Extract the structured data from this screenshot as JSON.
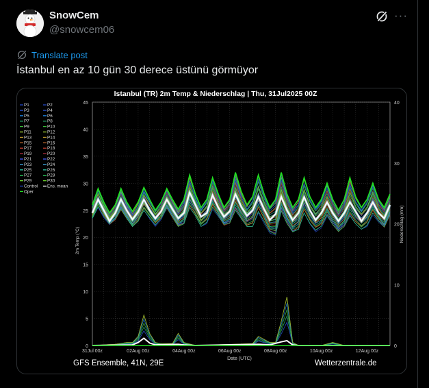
{
  "author": {
    "name": "SnowCem",
    "handle": "@snowcem06"
  },
  "translate_label": "Translate post",
  "tweet_text": "İstanbul en az 10 gün 30 derece üstünü görmüyor",
  "chart_data": {
    "type": "line",
    "title": "Istanbul  (TR)  2m Temp & Niederschlag | Thu, 31Jul2025 00Z",
    "footer_left": "GFS Ensemble, 41N, 29E",
    "footer_right": "Wetterzentrale.de",
    "xlabel": "Date (UTC)",
    "ylabel_left": "2m Temp (°C)",
    "ylabel_right": "Niederschlag (mm)",
    "ylim_left": [
      0,
      45
    ],
    "ylim_right": [
      0,
      40
    ],
    "yticks_left": [
      "0",
      "5",
      "10",
      "15",
      "20",
      "25",
      "30",
      "35",
      "40",
      "45"
    ],
    "yticks_right": [
      "0",
      "10",
      "20",
      "30",
      "40"
    ],
    "x_range_hours": [
      0,
      312
    ],
    "xticks": [
      {
        "hour": 0,
        "label": "31Jul 00z"
      },
      {
        "hour": 48,
        "label": "02Aug 00z"
      },
      {
        "hour": 96,
        "label": "04Aug 00z"
      },
      {
        "hour": 144,
        "label": "06Aug 00z"
      },
      {
        "hour": 192,
        "label": "08Aug 00z"
      },
      {
        "hour": 240,
        "label": "10Aug 00z"
      },
      {
        "hour": 288,
        "label": "12Aug 00z"
      }
    ],
    "legend_placement": "left",
    "legend": [
      {
        "name": "P1",
        "color": "#1f3fae"
      },
      {
        "name": "P2",
        "color": "#1f3fae"
      },
      {
        "name": "P3",
        "color": "#2a55d8"
      },
      {
        "name": "P4",
        "color": "#2a55d8"
      },
      {
        "name": "P5",
        "color": "#1c7fd8"
      },
      {
        "name": "P6",
        "color": "#1c7fd8"
      },
      {
        "name": "P7",
        "color": "#24a86a"
      },
      {
        "name": "P8",
        "color": "#24a86a"
      },
      {
        "name": "P9",
        "color": "#38b838"
      },
      {
        "name": "P10",
        "color": "#38b838"
      },
      {
        "name": "P11",
        "color": "#8fb82e"
      },
      {
        "name": "P12",
        "color": "#8fb82e"
      },
      {
        "name": "P13",
        "color": "#b38f2a"
      },
      {
        "name": "P14",
        "color": "#b38f2a"
      },
      {
        "name": "P15",
        "color": "#b8652a"
      },
      {
        "name": "P16",
        "color": "#b8652a"
      },
      {
        "name": "P17",
        "color": "#b83a2a"
      },
      {
        "name": "P18",
        "color": "#b83a2a"
      },
      {
        "name": "P19",
        "color": "#a82a3a"
      },
      {
        "name": "P20",
        "color": "#a82a3a"
      },
      {
        "name": "P21",
        "color": "#3a4fd8"
      },
      {
        "name": "P22",
        "color": "#3a4fd8"
      },
      {
        "name": "P23",
        "color": "#3aa0d8"
      },
      {
        "name": "P24",
        "color": "#3aa0d8"
      },
      {
        "name": "P25",
        "color": "#2ac0a0"
      },
      {
        "name": "P26",
        "color": "#2ac0a0"
      },
      {
        "name": "P27",
        "color": "#2ad060"
      },
      {
        "name": "P28",
        "color": "#2ad060"
      },
      {
        "name": "P29",
        "color": "#6ad02a"
      },
      {
        "name": "P30",
        "color": "#6ad02a"
      },
      {
        "name": "Control",
        "color": "#1f3fae"
      },
      {
        "name": "Ens. mean",
        "color": "#ffffff"
      },
      {
        "name": "Oper",
        "color": "#22dd22"
      }
    ],
    "temp_mean": [
      [
        0,
        24.5
      ],
      [
        6,
        27
      ],
      [
        12,
        25
      ],
      [
        18,
        23
      ],
      [
        24,
        24.5
      ],
      [
        30,
        27
      ],
      [
        36,
        25
      ],
      [
        42,
        23.3
      ],
      [
        48,
        24.7
      ],
      [
        54,
        27
      ],
      [
        60,
        25
      ],
      [
        66,
        23.5
      ],
      [
        72,
        24.8
      ],
      [
        78,
        27
      ],
      [
        84,
        25.2
      ],
      [
        90,
        23.5
      ],
      [
        96,
        24.5
      ],
      [
        102,
        28.3
      ],
      [
        108,
        26
      ],
      [
        114,
        23.8
      ],
      [
        120,
        24.5
      ],
      [
        126,
        27.8
      ],
      [
        132,
        25.5
      ],
      [
        138,
        23.8
      ],
      [
        144,
        24.8
      ],
      [
        150,
        28
      ],
      [
        156,
        25.7
      ],
      [
        162,
        24
      ],
      [
        168,
        25
      ],
      [
        174,
        27.5
      ],
      [
        180,
        25.2
      ],
      [
        186,
        23.2
      ],
      [
        192,
        24.3
      ],
      [
        198,
        27.5
      ],
      [
        204,
        25
      ],
      [
        210,
        23.2
      ],
      [
        216,
        24.5
      ],
      [
        222,
        27.5
      ],
      [
        228,
        25
      ],
      [
        234,
        23.2
      ],
      [
        240,
        24.5
      ],
      [
        246,
        26.5
      ],
      [
        252,
        24.5
      ],
      [
        258,
        23
      ],
      [
        264,
        24.5
      ],
      [
        270,
        26.5
      ],
      [
        276,
        24.8
      ],
      [
        282,
        23
      ],
      [
        288,
        24.5
      ],
      [
        294,
        26.5
      ],
      [
        300,
        24.5
      ],
      [
        306,
        23.5
      ],
      [
        312,
        26
      ]
    ],
    "temp_spread_max": [
      [
        0,
        26
      ],
      [
        6,
        29
      ],
      [
        12,
        26.5
      ],
      [
        18,
        24.5
      ],
      [
        24,
        26
      ],
      [
        30,
        29
      ],
      [
        36,
        26.5
      ],
      [
        42,
        24.8
      ],
      [
        48,
        26.5
      ],
      [
        54,
        29.2
      ],
      [
        60,
        27
      ],
      [
        66,
        25
      ],
      [
        72,
        26.5
      ],
      [
        78,
        29
      ],
      [
        84,
        27
      ],
      [
        90,
        25.2
      ],
      [
        96,
        27
      ],
      [
        102,
        31.5
      ],
      [
        108,
        28
      ],
      [
        114,
        25.5
      ],
      [
        120,
        27
      ],
      [
        126,
        31
      ],
      [
        132,
        28
      ],
      [
        138,
        25.5
      ],
      [
        144,
        27
      ],
      [
        150,
        32
      ],
      [
        156,
        28.5
      ],
      [
        162,
        26
      ],
      [
        168,
        27.5
      ],
      [
        174,
        31.5
      ],
      [
        180,
        28
      ],
      [
        186,
        25.5
      ],
      [
        192,
        27
      ],
      [
        198,
        32
      ],
      [
        204,
        28
      ],
      [
        210,
        25.5
      ],
      [
        216,
        27
      ],
      [
        222,
        31
      ],
      [
        228,
        27.5
      ],
      [
        234,
        25.5
      ],
      [
        240,
        27
      ],
      [
        246,
        30
      ],
      [
        252,
        27
      ],
      [
        258,
        25
      ],
      [
        264,
        27
      ],
      [
        270,
        31
      ],
      [
        276,
        27.5
      ],
      [
        282,
        25.5
      ],
      [
        288,
        27
      ],
      [
        294,
        30
      ],
      [
        300,
        27
      ],
      [
        306,
        25.5
      ],
      [
        312,
        28
      ]
    ],
    "temp_spread_min": [
      [
        0,
        23.5
      ],
      [
        6,
        25.5
      ],
      [
        12,
        23.5
      ],
      [
        18,
        22
      ],
      [
        24,
        23
      ],
      [
        30,
        25
      ],
      [
        36,
        23.5
      ],
      [
        42,
        22
      ],
      [
        48,
        23
      ],
      [
        54,
        25
      ],
      [
        60,
        23.5
      ],
      [
        66,
        22
      ],
      [
        72,
        23
      ],
      [
        78,
        25
      ],
      [
        84,
        23.5
      ],
      [
        90,
        22
      ],
      [
        96,
        22.5
      ],
      [
        102,
        25.5
      ],
      [
        108,
        24
      ],
      [
        114,
        22
      ],
      [
        120,
        22.5
      ],
      [
        126,
        25
      ],
      [
        132,
        23.5
      ],
      [
        138,
        22
      ],
      [
        144,
        22.5
      ],
      [
        150,
        25
      ],
      [
        156,
        23.5
      ],
      [
        162,
        22
      ],
      [
        168,
        22
      ],
      [
        174,
        24.5
      ],
      [
        180,
        22.5
      ],
      [
        186,
        20.5
      ],
      [
        192,
        20
      ],
      [
        198,
        24.5
      ],
      [
        204,
        22.5
      ],
      [
        210,
        21
      ],
      [
        216,
        21.5
      ],
      [
        222,
        24.5
      ],
      [
        228,
        22.5
      ],
      [
        234,
        21
      ],
      [
        240,
        21.5
      ],
      [
        246,
        23.5
      ],
      [
        252,
        22
      ],
      [
        258,
        21
      ],
      [
        264,
        22
      ],
      [
        270,
        24
      ],
      [
        276,
        22.5
      ],
      [
        282,
        21.5
      ],
      [
        288,
        22
      ],
      [
        294,
        24
      ],
      [
        300,
        22.5
      ],
      [
        306,
        21.5
      ],
      [
        312,
        24
      ]
    ],
    "precip_peak": [
      [
        0,
        0
      ],
      [
        24,
        0.2
      ],
      [
        36,
        0.5
      ],
      [
        42,
        0.5
      ],
      [
        48,
        1.5
      ],
      [
        54,
        5
      ],
      [
        60,
        2
      ],
      [
        66,
        0.5
      ],
      [
        72,
        0.3
      ],
      [
        84,
        0.3
      ],
      [
        90,
        2
      ],
      [
        96,
        0.5
      ],
      [
        108,
        0
      ],
      [
        168,
        0.3
      ],
      [
        174,
        1.5
      ],
      [
        180,
        1
      ],
      [
        186,
        0.5
      ],
      [
        192,
        0.5
      ],
      [
        198,
        4
      ],
      [
        204,
        8
      ],
      [
        210,
        0.5
      ],
      [
        216,
        0
      ],
      [
        240,
        0
      ],
      [
        252,
        0.5
      ],
      [
        264,
        0
      ],
      [
        312,
        0
      ]
    ],
    "precip_mean": [
      [
        0,
        0
      ],
      [
        42,
        0.1
      ],
      [
        48,
        0.5
      ],
      [
        54,
        1.2
      ],
      [
        60,
        0.4
      ],
      [
        66,
        0.1
      ],
      [
        90,
        0.2
      ],
      [
        96,
        0.1
      ],
      [
        108,
        0
      ],
      [
        174,
        0.2
      ],
      [
        186,
        0.1
      ],
      [
        198,
        0.6
      ],
      [
        204,
        0.8
      ],
      [
        210,
        0.1
      ],
      [
        216,
        0
      ],
      [
        312,
        0
      ]
    ]
  }
}
